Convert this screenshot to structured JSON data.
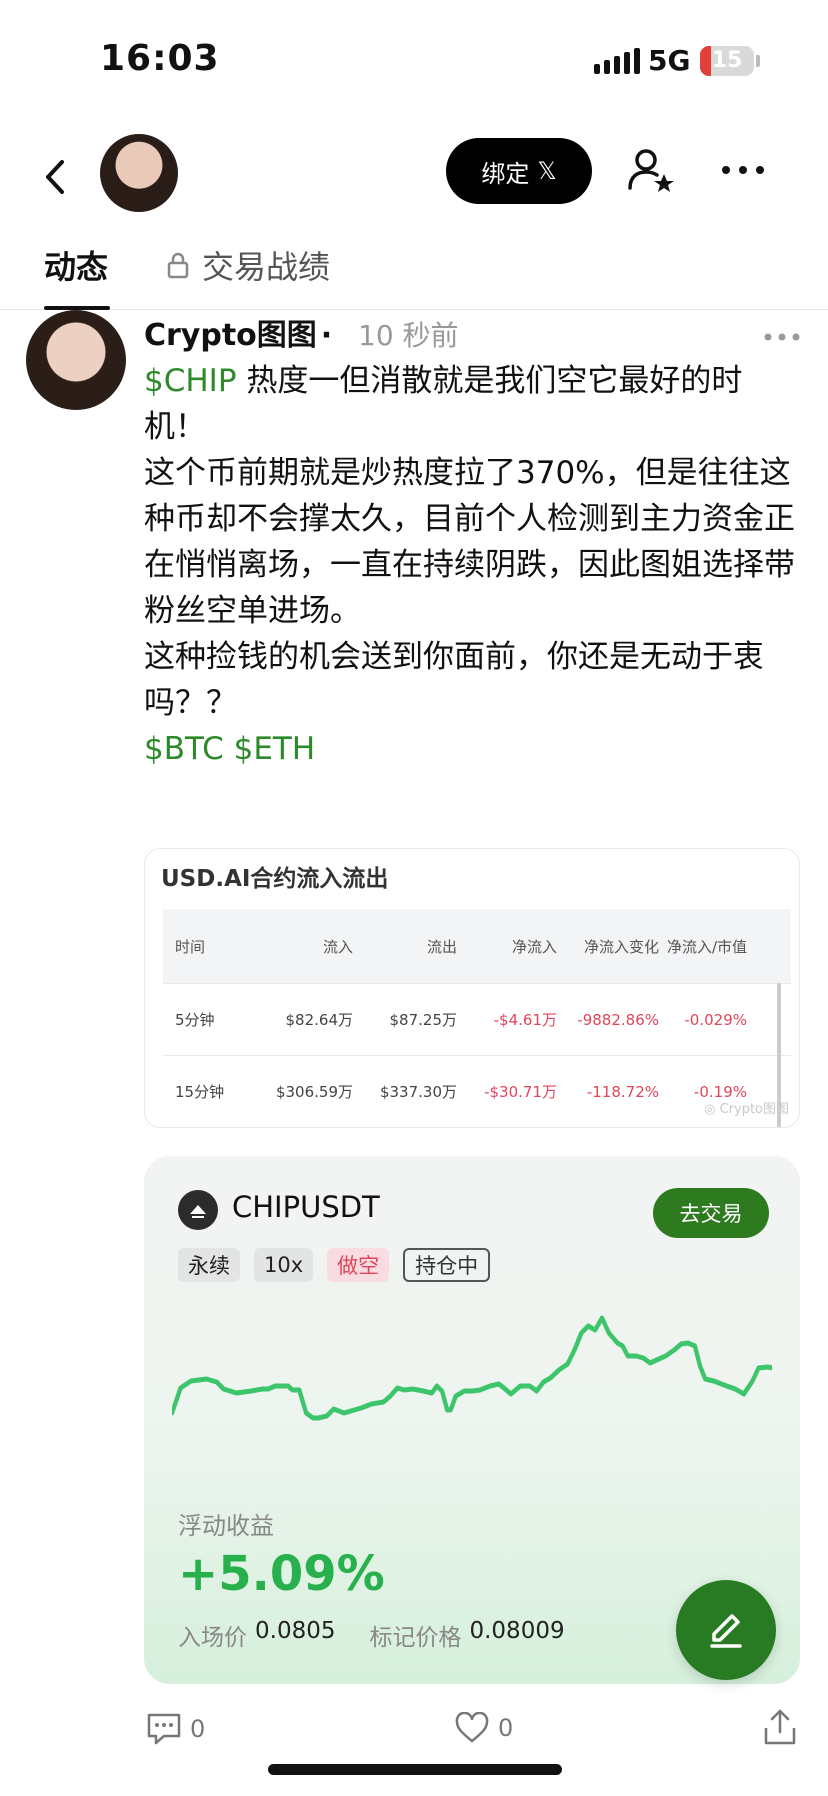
{
  "status": {
    "time": "16:03",
    "network": "5G",
    "battery": "15"
  },
  "header": {
    "bind_label": "绑定",
    "x_logo": "𝕏"
  },
  "tabs": [
    {
      "label": "动态"
    },
    {
      "label": "交易战绩"
    }
  ],
  "post": {
    "author": "Crypto图图",
    "separator": "·",
    "time": "10 秒前",
    "ticker": "$CHIP",
    "line1": " 热度一但消散就是我们空它最好的时机！",
    "line2": "这个币前期就是炒热度拉了370%，但是往往这种币却不会撑太久，目前个人检测到主力资金正在悄悄离场，一直在持续阴跌，因此图姐选择带粉丝空单进场。",
    "line3": "这种捡钱的机会送到你面前，你还是无动于衷吗？？",
    "tags": "$BTC $ETH"
  },
  "flow_table": {
    "title": "USD.AI合约流入流出",
    "headers": [
      "时间",
      "流入",
      "流出",
      "净流入",
      "净流入变化",
      "净流入/市值"
    ],
    "rows": [
      [
        "5分钟",
        "$82.64万",
        "$87.25万",
        "-$4.61万",
        "-9882.86%",
        "-0.029%"
      ],
      [
        "15分钟",
        "$306.59万",
        "$337.30万",
        "-$30.71万",
        "-118.72%",
        "-0.19%"
      ]
    ],
    "watermark": "Crypto图图"
  },
  "trade": {
    "symbol": "CHIPUSDT",
    "go_label": "去交易",
    "tags": [
      "永续",
      "10x",
      "做空",
      "持仓中"
    ],
    "pnl_label": "浮动收益",
    "pnl": "+5.09%",
    "entry_label": "入场价",
    "entry": "0.0805",
    "mark_label": "标记价格",
    "mark": "0.08009",
    "line_color": "#3cc56a"
  },
  "actions": {
    "comments": "0",
    "likes": "0"
  }
}
